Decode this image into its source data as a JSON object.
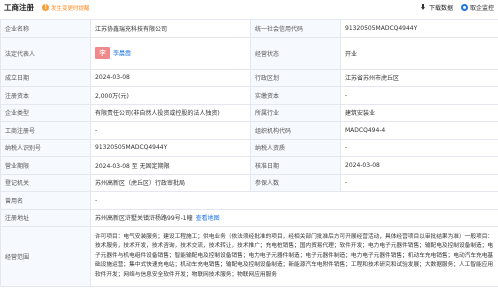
{
  "header": {
    "title": "工商注册",
    "notice": "发生变更时提醒",
    "download_label": "下载数据",
    "monitor_label": "取企监控"
  },
  "rows": {
    "company_name": {
      "label": "企业名称",
      "value": "江苏协鑫瑞充科技有限公司"
    },
    "credit_code": {
      "label": "统一社会信用代码",
      "value": "91320505MADCQ4944Y"
    },
    "legal_rep": {
      "label": "法定代表人",
      "avatar": "李",
      "value": "李晨霞"
    },
    "status": {
      "label": "经营状态",
      "value": "开业"
    },
    "established": {
      "label": "成立日期",
      "value": "2024-03-08"
    },
    "region": {
      "label": "行政区划",
      "value": "江苏省苏州市虎丘区"
    },
    "reg_capital": {
      "label": "注册资本",
      "value": "2,000万(元)"
    },
    "paid_capital": {
      "label": "实缴资本",
      "value": "-"
    },
    "company_type": {
      "label": "企业类型",
      "value": "有限责任公司(非自然人投资或控股的法人独资)"
    },
    "industry": {
      "label": "所属行业",
      "value": "建筑安装业"
    },
    "reg_number": {
      "label": "工商注册号",
      "value": "-"
    },
    "org_code": {
      "label": "组织机构代码",
      "value": "MADCQ494-4"
    },
    "taxpayer_id": {
      "label": "纳税人识别号",
      "value": "91320505MADCQ4944Y"
    },
    "taxpayer_qual": {
      "label": "纳税人资质",
      "value": "-"
    },
    "term": {
      "label": "营业期限",
      "value": "2024-03-08 至 无固定期限"
    },
    "approval_date": {
      "label": "核准日期",
      "value": "2024-03-08"
    },
    "authority": {
      "label": "登记机关",
      "value": "苏州高新区（虎丘区）行政审批局"
    },
    "insured": {
      "label": "参保人数",
      "value": "-"
    },
    "former_name": {
      "label": "曾用名",
      "value": "-"
    },
    "address": {
      "label": "注册地址",
      "value": "苏州高新区浒墅关镇浒杨路99号-1幢",
      "link": "查看地图"
    },
    "business_scope": {
      "label": "经营范围",
      "value": "许可项目：电气安装服务；建设工程施工；供电业务（依法须经批准的项目，经相关部门批准后方可开展经营活动，具体经营项目以审批结果为准）一般项目：技术服务，技术开发，技术咨询，技术交流，技术转让，技术推广；充电桩销售；国内贸易代理；软件开发；电力电子元器件销售；输配电及控制设备制造；电子元器件与机电组件设备销售；智能输配电及控制设备销售；电力电子元器件制造；电子元器件制造；电力电子元器件销售；机动车充电销售；电动汽车充电基础设施运营；集中式快速充电站；机动车充电销售；输配电及控制设备制造；新能源汽车电附件销售；工程和技术研究和试验发展；大数据服务；人工智能应用软件开发；网络与信息安全软件开发；物联网技术服务；物联网应用服务"
    }
  }
}
